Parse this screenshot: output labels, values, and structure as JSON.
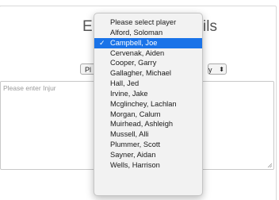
{
  "form": {
    "title_left": "E",
    "title_right": "ils",
    "select_left_value": "Pl",
    "select_right_value": "y",
    "select_right_arrows": "⬍",
    "injury_placeholder": "Please enter Injur"
  },
  "player_dropdown": {
    "options": [
      {
        "label": "Please select player",
        "selected": false
      },
      {
        "label": "Alford, Soloman",
        "selected": false
      },
      {
        "label": "Campbell, Joe",
        "selected": true
      },
      {
        "label": "Cervenak, Aiden",
        "selected": false
      },
      {
        "label": "Cooper, Garry",
        "selected": false
      },
      {
        "label": "Gallagher, Michael",
        "selected": false
      },
      {
        "label": "Hall, Jed",
        "selected": false
      },
      {
        "label": "Irvine, Jake",
        "selected": false
      },
      {
        "label": "Mcglinchey, Lachlan",
        "selected": false
      },
      {
        "label": "Morgan, Calum",
        "selected": false
      },
      {
        "label": "Muirhead, Ashleigh",
        "selected": false
      },
      {
        "label": "Mussell, Alli",
        "selected": false
      },
      {
        "label": "Plummer, Scott",
        "selected": false
      },
      {
        "label": "Sayner, Aidan",
        "selected": false
      },
      {
        "label": "Wells, Harrison",
        "selected": false
      }
    ],
    "selected_check": "✓"
  },
  "colors": {
    "selected_bg": "#1a73e8",
    "dropdown_bg": "#f2f2f2",
    "placeholder": "#9a9a9a"
  }
}
